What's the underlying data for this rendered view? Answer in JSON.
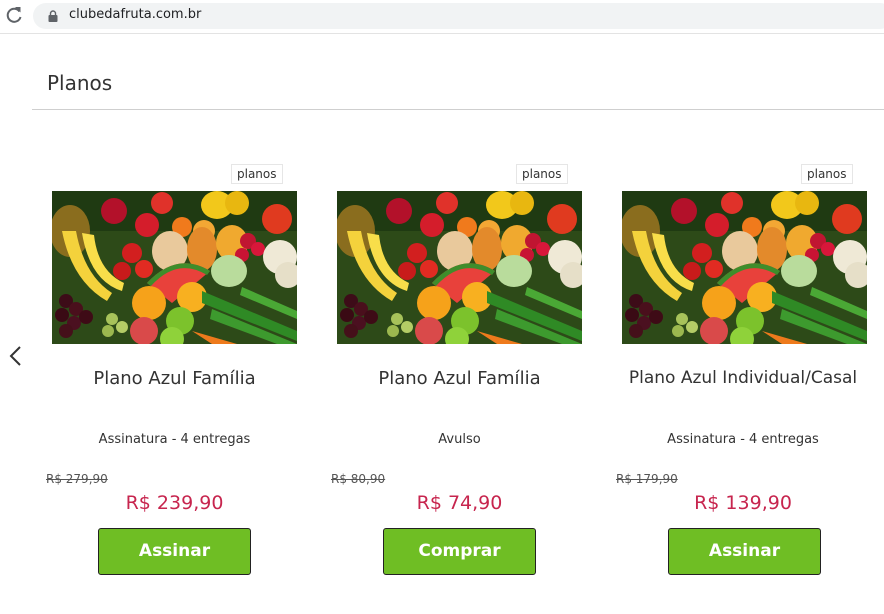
{
  "browser": {
    "url": "clubedafruta.com.br",
    "reload_icon": "reload-icon",
    "lock_icon": "lock-icon"
  },
  "page": {
    "title": "Planos",
    "prev_icon": "chevron-left-icon"
  },
  "plans": [
    {
      "tag": "planos",
      "name": "Plano Azul Família",
      "type": "Assinatura - 4 entregas",
      "old_price": "R$ 279,90",
      "price": "R$ 239,90",
      "button": "Assinar",
      "image_icon": "fruit-vegetable-photo"
    },
    {
      "tag": "planos",
      "name": "Plano Azul Família",
      "type": "Avulso",
      "old_price": "R$ 80,90",
      "price": "R$ 74,90",
      "button": "Comprar",
      "image_icon": "fruit-vegetable-photo"
    },
    {
      "tag": "planos",
      "name": "Plano Azul Individual/Casal",
      "type": "Assinatura - 4 entregas",
      "old_price": "R$ 179,90",
      "price": "R$ 139,90",
      "button": "Assinar",
      "image_icon": "fruit-vegetable-photo"
    }
  ],
  "colors": {
    "price": "#c7254e",
    "button": "#6fbe24"
  }
}
